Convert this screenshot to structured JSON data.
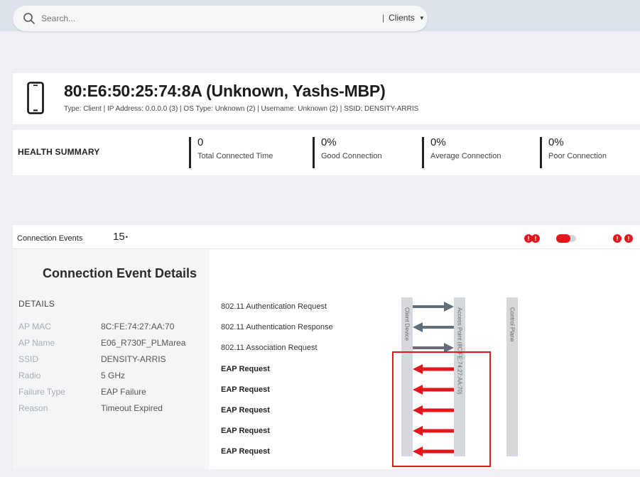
{
  "search": {
    "placeholder": "Search...",
    "scope": "Clients"
  },
  "device": {
    "title": "80:E6:50:25:74:8A (Unknown, Yashs-MBP)",
    "meta": "Type: Client  |  IP Address: 0.0.0.0 (3)  |  OS Type: Unknown (2)  |  Username: Unknown (2)  |  SSID: DENSITY-ARRIS"
  },
  "health": {
    "title": "HEALTH SUMMARY",
    "metrics": [
      {
        "value": "0",
        "label": "Total Connected Time"
      },
      {
        "value": "0%",
        "label": "Good Connection"
      },
      {
        "value": "0%",
        "label": "Average Connection"
      },
      {
        "value": "0%",
        "label": "Poor Connection"
      }
    ]
  },
  "events": {
    "label": "Connection Events",
    "count": "15",
    "count_suffix": "•"
  },
  "details": {
    "heading": "Connection Event Details",
    "subheading": "DETAILS",
    "rows": [
      {
        "key": "AP MAC",
        "value": "8C:FE:74:27:AA:70"
      },
      {
        "key": "AP Name",
        "value": "E06_R730F_PLMarea"
      },
      {
        "key": "SSID",
        "value": "DENSITY-ARRIS"
      },
      {
        "key": "Radio",
        "value": "5 GHz"
      },
      {
        "key": "Failure Type",
        "value": "EAP Failure"
      },
      {
        "key": "Reason",
        "value": "Timeout Expired"
      }
    ]
  },
  "flow": {
    "lanes": [
      "Client Device",
      "Access Point (8C:FE:74:27:AA:70)",
      "Control Plane"
    ],
    "events": [
      {
        "label": "802.11 Authentication Request",
        "direction": "right",
        "status": "normal"
      },
      {
        "label": "802.11 Authentication Response",
        "direction": "left",
        "status": "normal"
      },
      {
        "label": "802.11 Association Request",
        "direction": "right",
        "status": "normal"
      },
      {
        "label": "EAP Request",
        "direction": "left",
        "status": "failure"
      },
      {
        "label": "EAP Request",
        "direction": "left",
        "status": "failure"
      },
      {
        "label": "EAP Request",
        "direction": "left",
        "status": "failure"
      },
      {
        "label": "EAP Request",
        "direction": "left",
        "status": "failure"
      },
      {
        "label": "EAP Request",
        "direction": "left",
        "status": "failure"
      }
    ]
  },
  "colors": {
    "alert": "#e3161b",
    "arrow_normal": "#5f6f7c",
    "lane": "#d5d8dc"
  },
  "icons": [
    "search-icon",
    "chevron-down-icon",
    "phone-icon",
    "alert-icon",
    "toggle-switch"
  ]
}
